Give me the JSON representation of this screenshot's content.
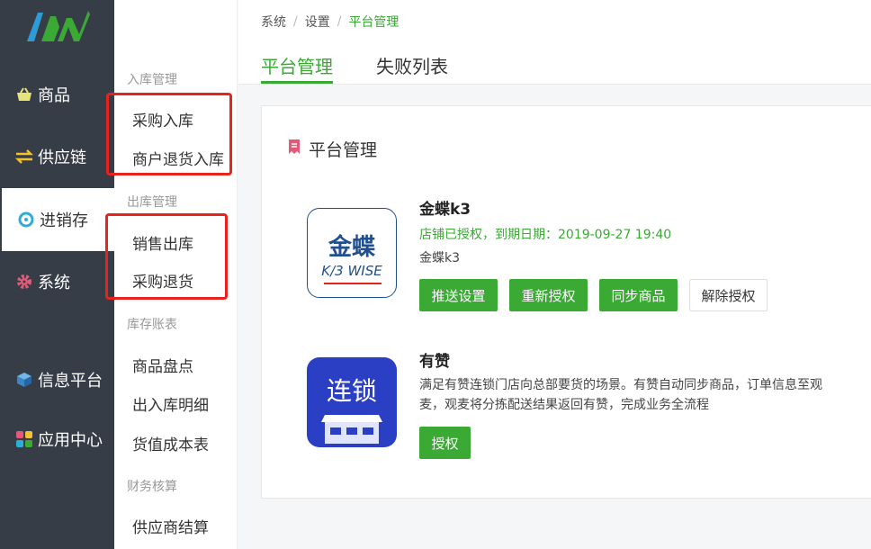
{
  "nav": {
    "items": [
      {
        "label": "商品",
        "icon": "basket-icon"
      },
      {
        "label": "供应链",
        "icon": "exchange-icon"
      },
      {
        "label": "进销存",
        "icon": "cycle-icon"
      },
      {
        "label": "系统",
        "icon": "gear-icon"
      },
      {
        "label": "信息平台",
        "icon": "cube-icon"
      },
      {
        "label": "应用中心",
        "icon": "apps-icon"
      }
    ],
    "active": "进销存"
  },
  "submenu": {
    "sections": [
      {
        "title": "入库管理",
        "items": [
          "采购入库",
          "商户退货入库"
        ]
      },
      {
        "title": "出库管理",
        "items": [
          "销售出库",
          "采购退货"
        ]
      },
      {
        "title": "库存账表",
        "items": [
          "商品盘点",
          "出入库明细",
          "货值成本表"
        ]
      },
      {
        "title": "财务核算",
        "items": [
          "供应商结算"
        ]
      }
    ]
  },
  "breadcrumb": [
    "系统",
    "设置",
    "平台管理"
  ],
  "tabs": [
    "平台管理",
    "失败列表"
  ],
  "card": {
    "title": "平台管理",
    "apps": [
      {
        "name": "金蝶k3",
        "logo_text_top": "金蝶",
        "logo_text_bottom": "K/3 WISE",
        "status": "店铺已授权，到期日期：2019-09-27 19:40",
        "desc": "金蝶k3",
        "buttons": [
          "推送设置",
          "重新授权",
          "同步商品",
          "解除授权"
        ]
      },
      {
        "name": "有赞",
        "logo_text": "连锁",
        "desc_line1": "满足有赞连锁门店向总部要货的场景。有赞自动同步商品，订单信息至观",
        "desc_line2": "麦，观麦将分拣配送结果返回有赞，完成业务全流程",
        "buttons": [
          "授权"
        ]
      }
    ]
  },
  "colors": {
    "accent": "#3aaa35",
    "nav_bg": "#363d47",
    "highlight_box": "#e8231d"
  }
}
